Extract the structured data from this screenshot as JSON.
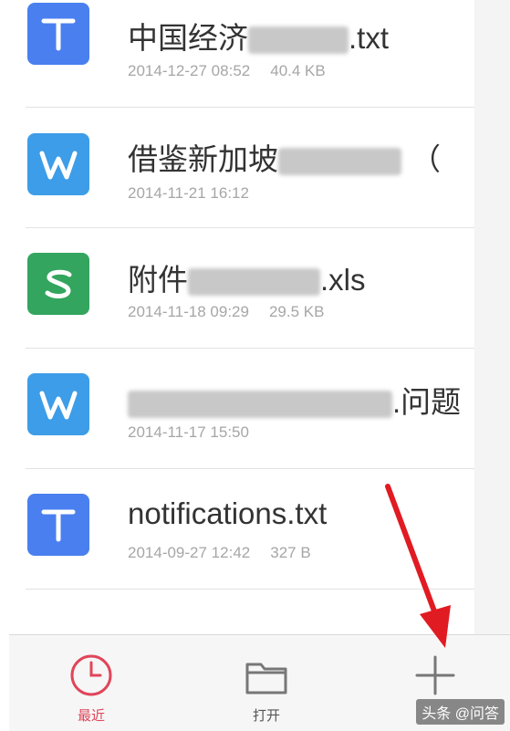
{
  "files": [
    {
      "icon": "T-icon",
      "color": "#4a7ff0",
      "name_prefix": "中国经济",
      "name_suffix": ".txt",
      "date": "2014-12-27 08:52",
      "size": "40.4 KB"
    },
    {
      "icon": "W-icon",
      "color": "#3d9de8",
      "name_prefix": "借鉴新加坡",
      "name_suffix": "（",
      "date": "2014-11-21 16:12",
      "size": ""
    },
    {
      "icon": "S-icon",
      "color": "#33a55e",
      "name_prefix": "附件",
      "name_suffix": ".xls",
      "date": "2014-11-18 09:29",
      "size": "29.5 KB"
    },
    {
      "icon": "W-icon",
      "color": "#3d9de8",
      "name_prefix": "",
      "name_suffix": ".问题",
      "date": "2014-11-17 15:50",
      "size": ""
    },
    {
      "icon": "T-icon",
      "color": "#4a7ff0",
      "name_prefix": "notifications.txt",
      "name_suffix": "",
      "date": "2014-09-27 12:42",
      "size": "327 B"
    }
  ],
  "bottom_nav": {
    "recent_label": "最近",
    "open_label": "打开",
    "accent": "#e0455a"
  },
  "watermark": "头条 @问答"
}
